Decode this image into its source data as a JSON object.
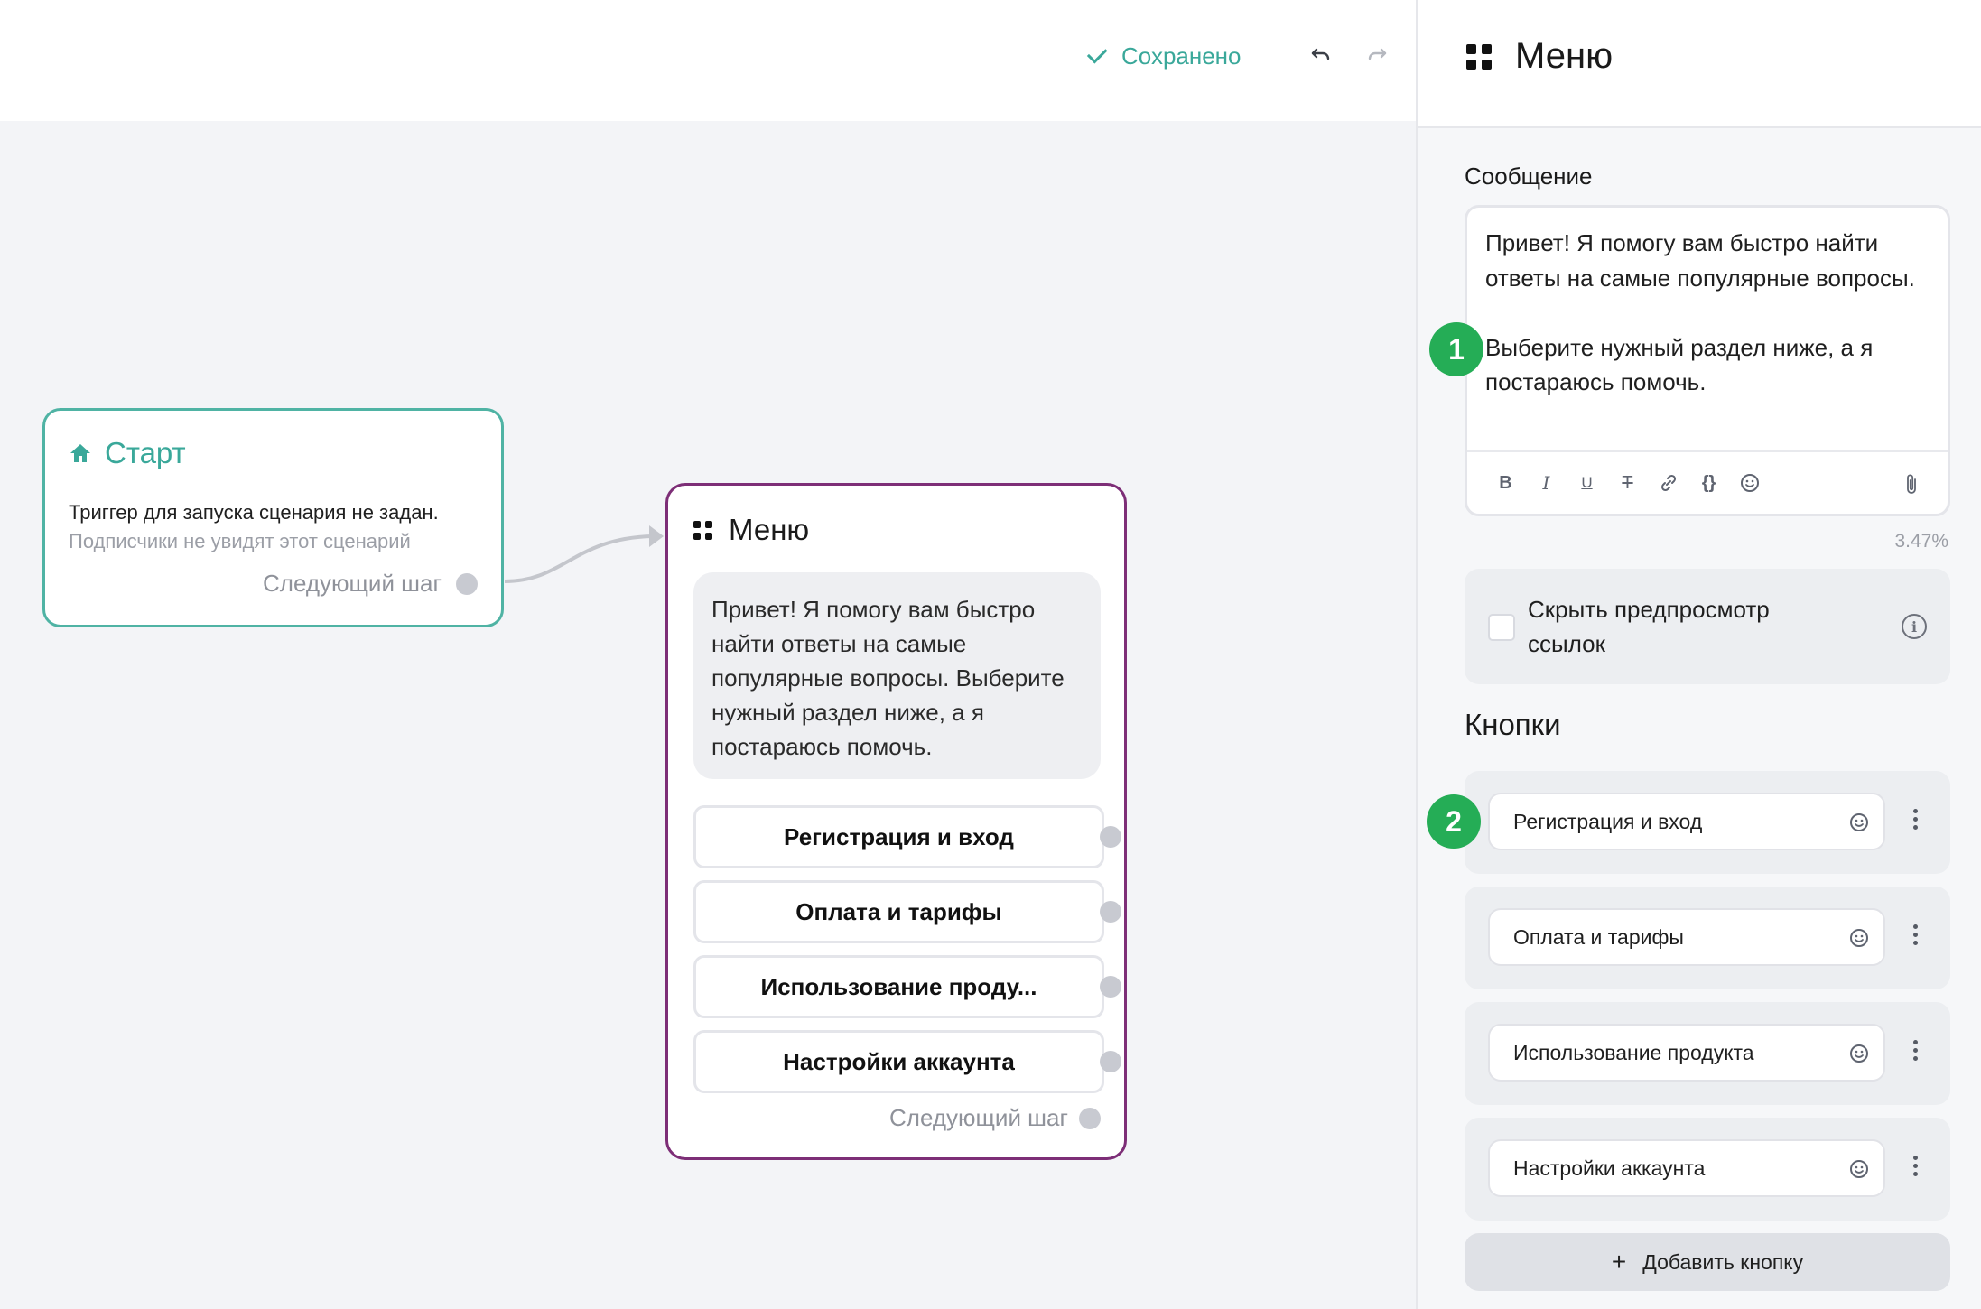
{
  "topbar": {
    "saved_label": "Сохранено",
    "undo_icon": "undo-icon",
    "redo_icon": "redo-icon"
  },
  "start_node": {
    "title": "Старт",
    "description": "Триггер для запуска сценария не задан.",
    "subtitle": "Подписчики не увидят этот сценарий",
    "next_label": "Следующий шаг"
  },
  "menu_node": {
    "title": "Меню",
    "message": "Привет! Я помогу вам быстро найти ответы на самые популярные вопросы. Выберите нужный раздел ниже, а я постараюсь помочь.",
    "buttons": [
      {
        "label": "Регистрация и вход"
      },
      {
        "label": "Оплата и тарифы"
      },
      {
        "label": "Использование проду..."
      },
      {
        "label": "Настройки аккаунта"
      }
    ],
    "next_label": "Следующий шаг"
  },
  "panel": {
    "title": "Меню",
    "message_label": "Сообщение",
    "message_text": "Привет! Я помогу вам быстро найти ответы на самые популярные вопросы.\n\nВыберите нужный раздел ниже, а я постараюсь помочь.",
    "toolbar": {
      "bold": "B",
      "italic": "I",
      "underline": "U",
      "strike": "T",
      "variables": "{}"
    },
    "usage_percent": "3.47%",
    "hide_preview_label": "Скрыть предпросмотр ссылок",
    "hide_preview_checked": false,
    "buttons_heading": "Кнопки",
    "buttons": [
      {
        "label": "Регистрация и вход"
      },
      {
        "label": "Оплата и тарифы"
      },
      {
        "label": "Использование продукта"
      },
      {
        "label": "Настройки аккаунта"
      }
    ],
    "add_button_label": "Добавить кнопку",
    "add_button_plus": "+"
  },
  "badges": [
    "1",
    "2"
  ],
  "colors": {
    "accent_teal": "#3aa89a",
    "menu_border": "#7d2e77",
    "badge_green": "#25ad56"
  }
}
